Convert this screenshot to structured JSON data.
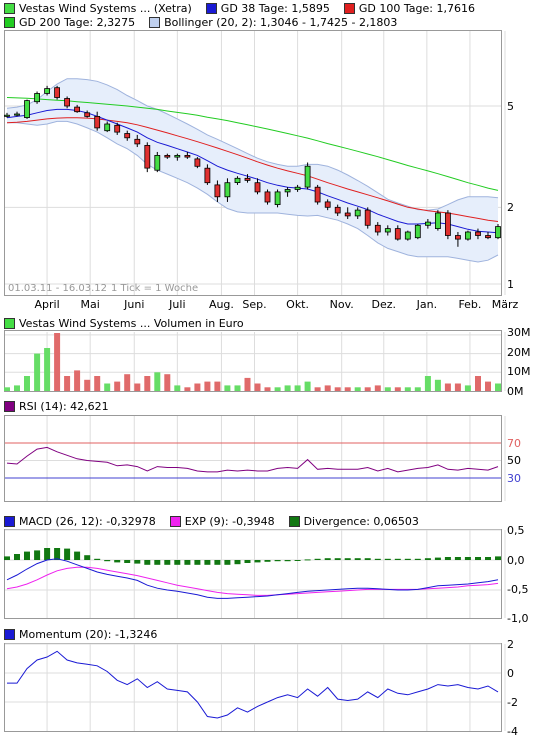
{
  "price_legend": {
    "row1": [
      {
        "label": "Vestas Wind Systems ... (Xetra)",
        "color": "#44dd44"
      },
      {
        "label": "GD 38 Tage: 1,5895",
        "color": "#1a1ad4"
      },
      {
        "label": "GD 100 Tage: 1,7616",
        "color": "#e02020"
      }
    ],
    "row2": [
      {
        "label": "GD 200 Tage: 2,3275",
        "color": "#22cc22"
      },
      {
        "label": "Bollinger (20, 2): 1,3046 - 1,7425 - 2,1803",
        "color": "#c0d0ee"
      }
    ]
  },
  "price_panel": {
    "y_ticks": [
      "5",
      "2",
      "1"
    ],
    "date_range": "01.03.11 - 16.03.12",
    "tick_info": "1 Tick = 1 Woche",
    "months": [
      "April",
      "Mai",
      "Juni",
      "Juli",
      "Aug.",
      "Sep.",
      "Okt.",
      "Nov.",
      "Dez.",
      "Jan.",
      "Feb.",
      "März"
    ]
  },
  "volume_panel": {
    "title": "Vestas Wind Systems ... Volumen in Euro",
    "color": "#44dd44",
    "y_ticks": [
      "30M",
      "20M",
      "10M",
      "0M"
    ]
  },
  "rsi_panel": {
    "title": "RSI (14): 42,621",
    "color": "#800080",
    "y_ticks": [
      "70",
      "50",
      "30"
    ],
    "ref_high": "70",
    "ref_low": "30"
  },
  "macd_panel": {
    "items": [
      {
        "label": "MACD (26, 12): -0,32978",
        "color": "#1a1ad4"
      },
      {
        "label": "EXP (9): -0,3948",
        "color": "#ee22ee"
      },
      {
        "label": "Divergence: 0,06503",
        "color": "#117711"
      }
    ],
    "y_ticks": [
      "0,5",
      "0,0",
      "-0,5",
      "-1,0"
    ]
  },
  "momentum_panel": {
    "title": "Momentum (20): -1,3246",
    "color": "#1a1ad4",
    "y_ticks": [
      "2",
      "0",
      "-2",
      "-4"
    ]
  },
  "chart_data": {
    "type": "candlestick",
    "title": "Vestas Wind Systems ... (Xetra)",
    "x_range": [
      "01.03.11",
      "16.03.12"
    ],
    "x_tick_labels": [
      "April",
      "Mai",
      "Juni",
      "Juli",
      "Aug.",
      "Sep.",
      "Okt.",
      "Nov.",
      "Dez.",
      "Jan.",
      "Feb.",
      "März"
    ],
    "price_scale": "log",
    "price_ylim": [
      1,
      6
    ],
    "candles": [
      {
        "o": 4.55,
        "h": 4.7,
        "l": 4.5,
        "c": 4.6
      },
      {
        "o": 4.6,
        "h": 4.75,
        "l": 4.55,
        "c": 4.65
      },
      {
        "o": 4.5,
        "h": 5.3,
        "l": 4.45,
        "c": 5.25
      },
      {
        "o": 5.2,
        "h": 5.7,
        "l": 5.1,
        "c": 5.6
      },
      {
        "o": 5.6,
        "h": 6.0,
        "l": 5.5,
        "c": 5.85
      },
      {
        "o": 5.9,
        "h": 6.0,
        "l": 5.3,
        "c": 5.4
      },
      {
        "o": 5.35,
        "h": 5.45,
        "l": 4.9,
        "c": 5.0
      },
      {
        "o": 4.95,
        "h": 5.05,
        "l": 4.7,
        "c": 4.75
      },
      {
        "o": 4.7,
        "h": 4.8,
        "l": 4.5,
        "c": 4.55
      },
      {
        "o": 4.55,
        "h": 4.75,
        "l": 4.0,
        "c": 4.1
      },
      {
        "o": 4.0,
        "h": 4.35,
        "l": 3.95,
        "c": 4.25
      },
      {
        "o": 4.2,
        "h": 4.3,
        "l": 3.85,
        "c": 3.95
      },
      {
        "o": 3.9,
        "h": 4.0,
        "l": 3.65,
        "c": 3.75
      },
      {
        "o": 3.7,
        "h": 3.85,
        "l": 3.45,
        "c": 3.55
      },
      {
        "o": 3.5,
        "h": 3.6,
        "l": 2.75,
        "c": 2.85
      },
      {
        "o": 2.8,
        "h": 3.3,
        "l": 2.75,
        "c": 3.2
      },
      {
        "o": 3.2,
        "h": 3.25,
        "l": 3.1,
        "c": 3.15
      },
      {
        "o": 3.15,
        "h": 3.25,
        "l": 3.05,
        "c": 3.2
      },
      {
        "o": 3.2,
        "h": 3.3,
        "l": 3.1,
        "c": 3.15
      },
      {
        "o": 3.1,
        "h": 3.15,
        "l": 2.85,
        "c": 2.9
      },
      {
        "o": 2.85,
        "h": 2.95,
        "l": 2.45,
        "c": 2.5
      },
      {
        "o": 2.45,
        "h": 2.55,
        "l": 2.1,
        "c": 2.2
      },
      {
        "o": 2.2,
        "h": 2.6,
        "l": 2.1,
        "c": 2.5
      },
      {
        "o": 2.5,
        "h": 2.65,
        "l": 2.45,
        "c": 2.6
      },
      {
        "o": 2.6,
        "h": 2.7,
        "l": 2.5,
        "c": 2.55
      },
      {
        "o": 2.5,
        "h": 2.6,
        "l": 2.25,
        "c": 2.3
      },
      {
        "o": 2.3,
        "h": 2.35,
        "l": 2.05,
        "c": 2.1
      },
      {
        "o": 2.05,
        "h": 2.35,
        "l": 2.0,
        "c": 2.3
      },
      {
        "o": 2.3,
        "h": 2.4,
        "l": 2.2,
        "c": 2.35
      },
      {
        "o": 2.35,
        "h": 2.45,
        "l": 2.3,
        "c": 2.4
      },
      {
        "o": 2.4,
        "h": 3.0,
        "l": 2.35,
        "c": 2.9
      },
      {
        "o": 2.4,
        "h": 2.45,
        "l": 2.05,
        "c": 2.1
      },
      {
        "o": 2.1,
        "h": 2.15,
        "l": 1.95,
        "c": 2.0
      },
      {
        "o": 2.0,
        "h": 2.05,
        "l": 1.85,
        "c": 1.9
      },
      {
        "o": 1.9,
        "h": 2.0,
        "l": 1.8,
        "c": 1.85
      },
      {
        "o": 1.85,
        "h": 2.0,
        "l": 1.8,
        "c": 1.95
      },
      {
        "o": 1.95,
        "h": 2.0,
        "l": 1.65,
        "c": 1.7
      },
      {
        "o": 1.7,
        "h": 1.75,
        "l": 1.55,
        "c": 1.6
      },
      {
        "o": 1.6,
        "h": 1.7,
        "l": 1.55,
        "c": 1.65
      },
      {
        "o": 1.65,
        "h": 1.7,
        "l": 1.48,
        "c": 1.5
      },
      {
        "o": 1.5,
        "h": 1.62,
        "l": 1.48,
        "c": 1.6
      },
      {
        "o": 1.52,
        "h": 1.72,
        "l": 1.5,
        "c": 1.7
      },
      {
        "o": 1.7,
        "h": 1.8,
        "l": 1.65,
        "c": 1.75
      },
      {
        "o": 1.65,
        "h": 1.95,
        "l": 1.62,
        "c": 1.9
      },
      {
        "o": 1.9,
        "h": 1.95,
        "l": 1.5,
        "c": 1.55
      },
      {
        "o": 1.55,
        "h": 1.6,
        "l": 1.4,
        "c": 1.5
      },
      {
        "o": 1.5,
        "h": 1.62,
        "l": 1.48,
        "c": 1.6
      },
      {
        "o": 1.6,
        "h": 1.65,
        "l": 1.5,
        "c": 1.55
      },
      {
        "o": 1.55,
        "h": 1.6,
        "l": 1.5,
        "c": 1.52
      },
      {
        "o": 1.52,
        "h": 1.72,
        "l": 1.5,
        "c": 1.68
      }
    ],
    "sma38": [
      4.5,
      4.55,
      4.6,
      4.7,
      4.8,
      4.85,
      4.85,
      4.8,
      4.7,
      4.55,
      4.4,
      4.25,
      4.1,
      3.95,
      3.75,
      3.6,
      3.5,
      3.4,
      3.3,
      3.2,
      3.05,
      2.9,
      2.8,
      2.72,
      2.65,
      2.58,
      2.5,
      2.44,
      2.4,
      2.38,
      2.36,
      2.3,
      2.22,
      2.15,
      2.08,
      2.02,
      1.96,
      1.88,
      1.82,
      1.76,
      1.72,
      1.72,
      1.73,
      1.74,
      1.72,
      1.68,
      1.64,
      1.61,
      1.6,
      1.59
    ],
    "sma100": [
      4.3,
      4.32,
      4.35,
      4.4,
      4.45,
      4.48,
      4.5,
      4.5,
      4.48,
      4.45,
      4.4,
      4.35,
      4.3,
      4.22,
      4.12,
      4.02,
      3.92,
      3.82,
      3.72,
      3.62,
      3.52,
      3.42,
      3.32,
      3.22,
      3.12,
      3.02,
      2.93,
      2.85,
      2.78,
      2.72,
      2.66,
      2.58,
      2.5,
      2.43,
      2.36,
      2.3,
      2.24,
      2.18,
      2.12,
      2.06,
      2.0,
      1.97,
      1.94,
      1.92,
      1.9,
      1.87,
      1.84,
      1.81,
      1.78,
      1.76
    ],
    "sma200": [
      5.4,
      5.38,
      5.36,
      5.33,
      5.3,
      5.27,
      5.24,
      5.2,
      5.16,
      5.12,
      5.08,
      5.04,
      5.0,
      4.95,
      4.9,
      4.85,
      4.78,
      4.72,
      4.66,
      4.6,
      4.52,
      4.45,
      4.38,
      4.3,
      4.22,
      4.14,
      4.06,
      3.98,
      3.9,
      3.82,
      3.74,
      3.65,
      3.56,
      3.48,
      3.4,
      3.32,
      3.24,
      3.16,
      3.08,
      3.0,
      2.92,
      2.85,
      2.78,
      2.71,
      2.64,
      2.57,
      2.5,
      2.44,
      2.38,
      2.33
    ],
    "bollinger_upper": [
      4.9,
      4.95,
      5.05,
      5.3,
      5.7,
      6.1,
      6.4,
      6.4,
      6.35,
      6.25,
      6.05,
      5.8,
      5.5,
      5.25,
      5.0,
      4.85,
      4.65,
      4.45,
      4.25,
      4.05,
      3.85,
      3.7,
      3.55,
      3.4,
      3.25,
      3.12,
      3.02,
      2.95,
      2.9,
      2.9,
      2.95,
      2.95,
      2.9,
      2.8,
      2.68,
      2.55,
      2.42,
      2.28,
      2.15,
      2.08,
      2.02,
      1.96,
      1.95,
      1.97,
      2.05,
      2.14,
      2.2,
      2.2,
      2.2,
      2.18
    ],
    "bollinger_lower": [
      4.3,
      4.3,
      4.25,
      4.2,
      4.25,
      4.35,
      4.35,
      4.25,
      4.1,
      3.95,
      3.75,
      3.55,
      3.4,
      3.2,
      2.95,
      2.8,
      2.7,
      2.6,
      2.5,
      2.38,
      2.25,
      2.1,
      1.98,
      1.92,
      1.9,
      1.9,
      1.9,
      1.9,
      1.88,
      1.86,
      1.85,
      1.86,
      1.82,
      1.78,
      1.72,
      1.65,
      1.55,
      1.45,
      1.38,
      1.34,
      1.3,
      1.28,
      1.28,
      1.28,
      1.28,
      1.26,
      1.24,
      1.22,
      1.24,
      1.3
    ],
    "volume_m": [
      2,
      3,
      8,
      20,
      23,
      31,
      8,
      11,
      6,
      8,
      4,
      5,
      9,
      4,
      8,
      10,
      9,
      3,
      2,
      4,
      5,
      5,
      3,
      3,
      7,
      4,
      2,
      2,
      3,
      3,
      5,
      2,
      3,
      2,
      2,
      2,
      2,
      3,
      2,
      2,
      2,
      2,
      8,
      6,
      4,
      4,
      3,
      8,
      5,
      4
    ],
    "volume_ylim": [
      0,
      32
    ],
    "rsi": [
      47,
      46,
      55,
      63,
      65,
      60,
      56,
      52,
      50,
      49,
      48,
      44,
      45,
      43,
      38,
      43,
      42,
      42,
      41,
      38,
      37,
      37,
      39,
      38,
      39,
      38,
      38,
      41,
      42,
      41,
      51,
      40,
      41,
      40,
      40,
      40,
      42,
      38,
      41,
      37,
      39,
      41,
      42,
      45,
      40,
      39,
      41,
      40,
      39,
      43
    ],
    "rsi_ylim": [
      0,
      100
    ],
    "macd": [
      -0.33,
      -0.25,
      -0.15,
      -0.06,
      0.0,
      0.02,
      -0.02,
      -0.08,
      -0.14,
      -0.2,
      -0.24,
      -0.27,
      -0.3,
      -0.34,
      -0.42,
      -0.47,
      -0.5,
      -0.52,
      -0.55,
      -0.58,
      -0.62,
      -0.64,
      -0.64,
      -0.63,
      -0.62,
      -0.61,
      -0.6,
      -0.58,
      -0.56,
      -0.54,
      -0.52,
      -0.51,
      -0.5,
      -0.49,
      -0.48,
      -0.47,
      -0.47,
      -0.48,
      -0.49,
      -0.5,
      -0.5,
      -0.49,
      -0.46,
      -0.43,
      -0.42,
      -0.41,
      -0.4,
      -0.38,
      -0.36,
      -0.33
    ],
    "exp": [
      -0.48,
      -0.45,
      -0.4,
      -0.33,
      -0.25,
      -0.18,
      -0.14,
      -0.12,
      -0.12,
      -0.14,
      -0.17,
      -0.2,
      -0.23,
      -0.26,
      -0.3,
      -0.34,
      -0.38,
      -0.42,
      -0.45,
      -0.48,
      -0.51,
      -0.54,
      -0.56,
      -0.57,
      -0.58,
      -0.59,
      -0.59,
      -0.58,
      -0.57,
      -0.56,
      -0.55,
      -0.54,
      -0.53,
      -0.52,
      -0.51,
      -0.5,
      -0.49,
      -0.49,
      -0.49,
      -0.49,
      -0.49,
      -0.49,
      -0.48,
      -0.47,
      -0.46,
      -0.45,
      -0.43,
      -0.42,
      -0.41,
      -0.39
    ],
    "macd_ylim": [
      -1.0,
      0.5
    ],
    "divergence": [
      0.06,
      0.1,
      0.14,
      0.16,
      0.2,
      0.2,
      0.19,
      0.14,
      0.08,
      0.02,
      -0.02,
      -0.04,
      -0.05,
      -0.06,
      -0.08,
      -0.08,
      -0.08,
      -0.08,
      -0.08,
      -0.08,
      -0.08,
      -0.08,
      -0.08,
      -0.07,
      -0.05,
      -0.04,
      -0.03,
      -0.02,
      -0.02,
      -0.01,
      0.01,
      0.02,
      0.03,
      0.03,
      0.03,
      0.03,
      0.03,
      0.02,
      0.02,
      0.02,
      0.02,
      0.02,
      0.03,
      0.04,
      0.05,
      0.05,
      0.05,
      0.05,
      0.05,
      0.06
    ],
    "momentum": [
      -0.7,
      -0.7,
      0.3,
      0.9,
      1.1,
      1.5,
      0.9,
      0.7,
      0.6,
      0.5,
      0.1,
      -0.5,
      -0.8,
      -0.4,
      -1.0,
      -0.6,
      -1.1,
      -1.2,
      -1.3,
      -2.0,
      -3.0,
      -3.1,
      -2.9,
      -2.4,
      -2.7,
      -2.3,
      -2.0,
      -1.7,
      -1.5,
      -1.7,
      -1.1,
      -1.6,
      -1.0,
      -1.8,
      -1.9,
      -1.8,
      -1.3,
      -1.7,
      -1.1,
      -1.4,
      -1.5,
      -1.3,
      -1.1,
      -0.8,
      -0.9,
      -0.8,
      -1.0,
      -1.1,
      -0.9,
      -1.3
    ],
    "momentum_ylim": [
      -4,
      2
    ]
  }
}
